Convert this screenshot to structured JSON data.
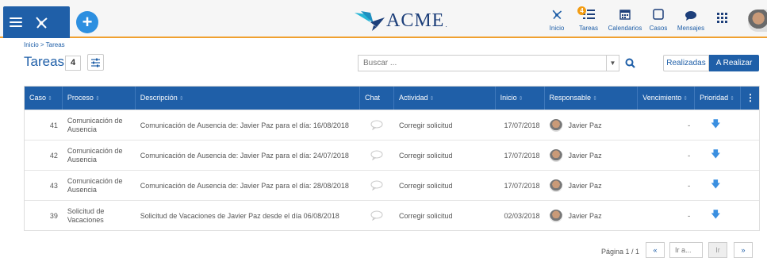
{
  "header": {
    "logo_text": "ACME",
    "logo_mark": ".",
    "nav": [
      {
        "label": "Inicio",
        "icon": "process-network-icon"
      },
      {
        "label": "Tareas",
        "icon": "tasks-icon",
        "badge": "4"
      },
      {
        "label": "Calendarios",
        "icon": "calendar-icon"
      },
      {
        "label": "Casos",
        "icon": "case-square-icon"
      },
      {
        "label": "Mensajes",
        "icon": "chat-bubble-icon"
      }
    ],
    "accent": "#f0a030",
    "brand": "#1f5fa8"
  },
  "page": {
    "breadcrumb": "Inicio > Tareas",
    "title": "Tareas",
    "count": "4",
    "search_placeholder": "Buscar ...",
    "segment_done": "Realizadas",
    "segment_todo": "A Realizar"
  },
  "table": {
    "columns": [
      "Caso",
      "Proceso",
      "Descripción",
      "Chat",
      "Actividad",
      "Inicio",
      "Responsable",
      "Vencimiento",
      "Prioridad"
    ],
    "rows": [
      {
        "caso": "41",
        "proceso": "Comunicación de Ausencia",
        "descripcion": "Comunicación de Ausencia de: Javier Paz para el día: 16/08/2018",
        "actividad": "Corregir solicitud",
        "inicio": "17/07/2018",
        "responsable": "Javier Paz",
        "vencimiento": "-"
      },
      {
        "caso": "42",
        "proceso": "Comunicación de Ausencia",
        "descripcion": "Comunicación de Ausencia de: Javier Paz para el día: 24/07/2018",
        "actividad": "Corregir solicitud",
        "inicio": "17/07/2018",
        "responsable": "Javier Paz",
        "vencimiento": "-"
      },
      {
        "caso": "43",
        "proceso": "Comunicación de Ausencia",
        "descripcion": "Comunicación de Ausencia de: Javier Paz para el día: 28/08/2018",
        "actividad": "Corregir solicitud",
        "inicio": "17/07/2018",
        "responsable": "Javier Paz",
        "vencimiento": "-"
      },
      {
        "caso": "39",
        "proceso": "Solicitud de Vacaciones",
        "descripcion": "Solicitud de Vacaciones de Javier  Paz desde el día 06/08/2018",
        "actividad": "Corregir solicitud",
        "inicio": "02/03/2018",
        "responsable": "Javier Paz",
        "vencimiento": "-"
      }
    ]
  },
  "pager": {
    "text": "Página 1 / 1",
    "prev": "«",
    "input_placeholder": "Ir a...",
    "go": "Ir",
    "next": "»"
  }
}
